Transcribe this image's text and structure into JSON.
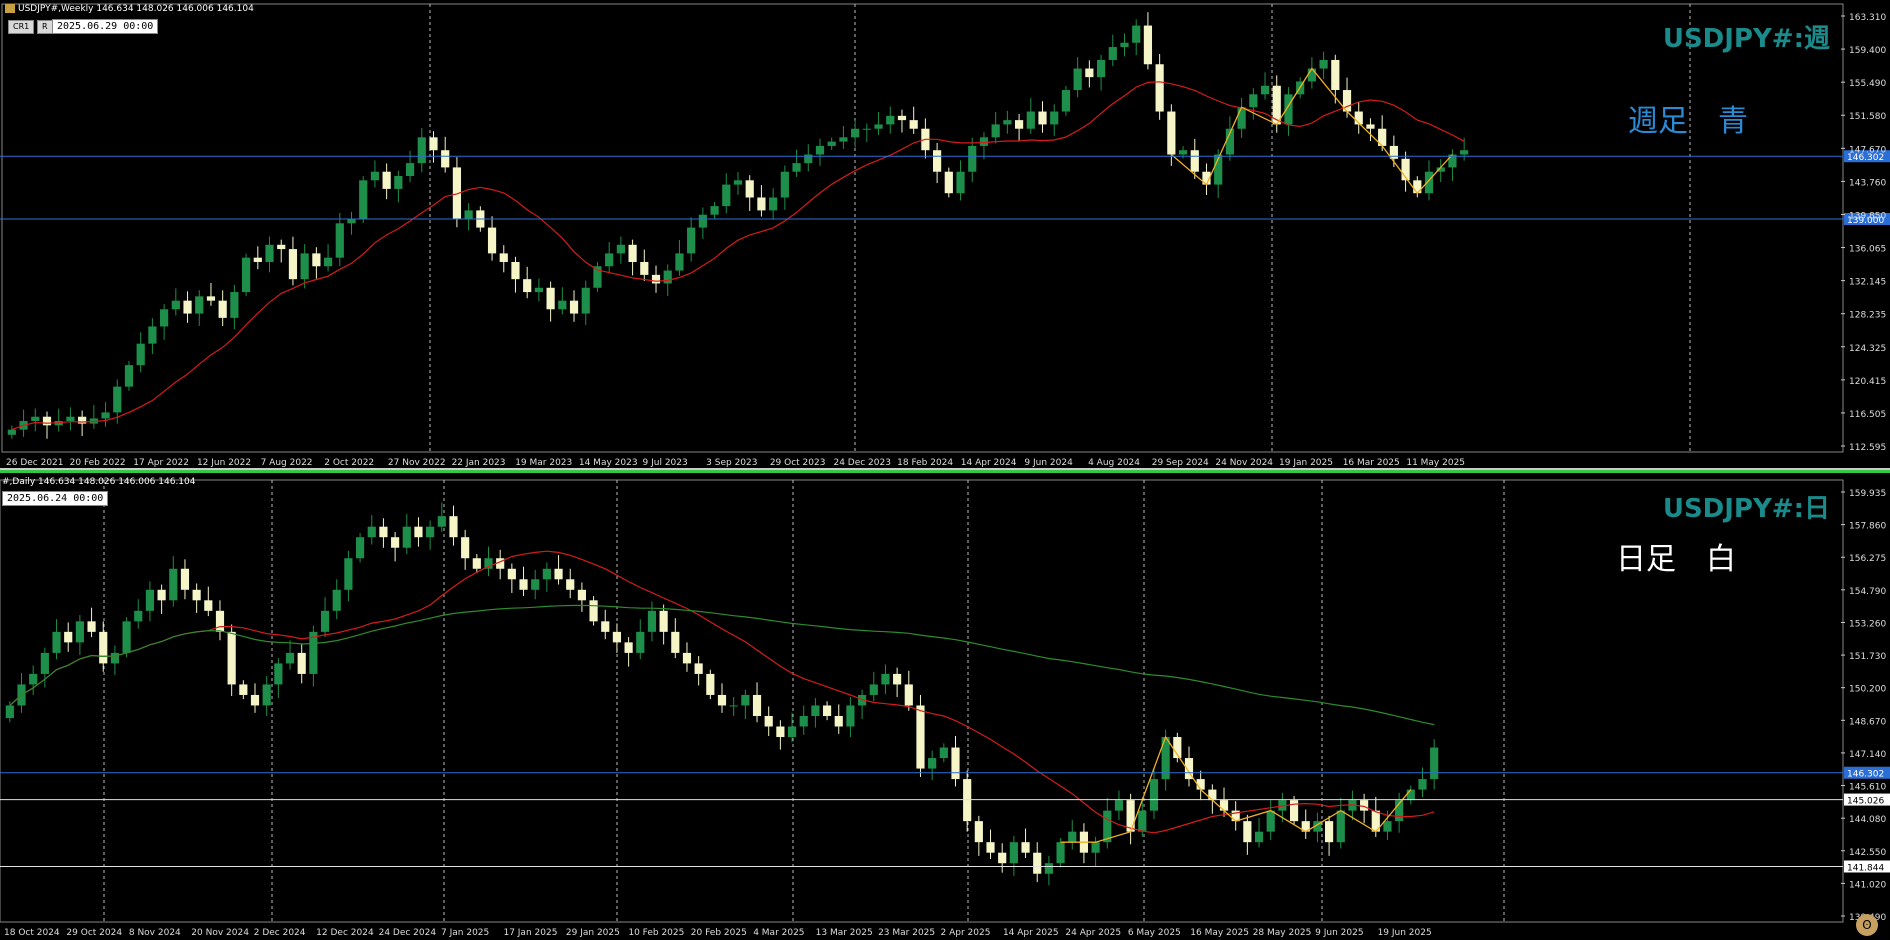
{
  "colors": {
    "background": "#000000",
    "bull_candle": "#1e8f4a",
    "bear_candle": "#f5f5c8",
    "ma_red": "#d41c1c",
    "ma_green": "#2e8b2e",
    "blue_line": "#2b6fd6",
    "white_line": "#e0e0e0",
    "zigzag": "#f0b020",
    "title_teal": "#1b8a8a"
  },
  "weekly": {
    "symbol_header": "USDJPY#,Weekly  146.634 148.026 146.006 146.104",
    "btn_cr1": "CR1",
    "btn_r": "R",
    "time_box": "2025.06.29 00:00",
    "chart_title": "USDJPY#:週",
    "note": "週足　青",
    "note_color": "#2b8ad6",
    "hline_labels": [
      "146.302",
      "139.000"
    ],
    "y_ticks": [
      "163.310",
      "159.400",
      "155.490",
      "151.580",
      "147.670",
      "143.760",
      "139.850",
      "136.065",
      "132.145",
      "128.235",
      "124.325",
      "120.415",
      "116.505",
      "112.595"
    ],
    "x_ticks": [
      "26 Dec 2021",
      "20 Feb 2022",
      "17 Apr 2022",
      "12 Jun 2022",
      "7 Aug 2022",
      "2 Oct 2022",
      "27 Nov 2022",
      "22 Jan 2023",
      "19 Mar 2023",
      "14 May 2023",
      "9 Jul 2023",
      "3 Sep 2023",
      "29 Oct 2023",
      "24 Dec 2023",
      "18 Feb 2024",
      "14 Apr 2024",
      "9 Jun 2024",
      "4 Aug 2024",
      "29 Sep 2024",
      "24 Nov 2024",
      "19 Jan 2025",
      "16 Mar 2025",
      "11 May 2025"
    ]
  },
  "daily": {
    "symbol_header": "#,Daily  146.634 148.026 146.006 146.104",
    "time_box": "2025.06.24 00:00",
    "chart_title": "USDJPY#:日",
    "note": "日足　白",
    "note_color": "#ffffff",
    "hline_labels": [
      "146.302",
      "145.026",
      "141.844"
    ],
    "y_ticks": [
      "159.935",
      "158.405",
      "156.875",
      "155.345",
      "153.815",
      "152.285",
      "150.755",
      "149.225",
      "147.695",
      "146.165",
      "144.635",
      "143.105",
      "141.575",
      "140.045"
    ],
    "y_ticks_shown": [
      "159.935",
      "157.860",
      "156.275",
      "154.790",
      "153.260",
      "151.730",
      "150.200",
      "148.670",
      "147.140",
      "145.610",
      "144.080",
      "142.550",
      "141.020",
      "139.490"
    ],
    "x_ticks": [
      "18 Oct 2024",
      "29 Oct 2024",
      "8 Nov 2024",
      "20 Nov 2024",
      "2 Dec 2024",
      "12 Dec 2024",
      "24 Dec 2024",
      "7 Jan 2025",
      "17 Jan 2025",
      "29 Jan 2025",
      "10 Feb 2025",
      "20 Feb 2025",
      "4 Mar 2025",
      "13 Mar 2025",
      "23 Mar 2025",
      "2 Apr 2025",
      "14 Apr 2025",
      "24 Apr 2025",
      "6 May 2025",
      "16 May 2025",
      "28 May 2025",
      "9 Jun 2025",
      "19 Jun 2025"
    ]
  },
  "chart_data": [
    {
      "type": "candlestick",
      "title": "USDJPY#:週",
      "timeframe": "Weekly",
      "ylim": [
        112.595,
        163.31
      ],
      "horizontal_lines": [
        146.302,
        139.0
      ],
      "closes_approx": [
        114.5,
        115.5,
        116.0,
        115.0,
        115.5,
        116.0,
        115.2,
        115.8,
        116.5,
        119.5,
        122.0,
        124.5,
        126.5,
        128.5,
        129.5,
        128.0,
        130.0,
        129.5,
        127.5,
        130.5,
        134.5,
        134.0,
        136.0,
        135.5,
        132.0,
        135.0,
        133.5,
        134.5,
        138.5,
        139.0,
        143.5,
        144.5,
        142.5,
        144.0,
        145.5,
        148.5,
        147.0,
        145.0,
        139.0,
        140.0,
        138.0,
        135.0,
        134.0,
        132.0,
        130.5,
        131.0,
        128.5,
        129.5,
        128.0,
        131.0,
        133.5,
        135.0,
        136.0,
        134.0,
        132.5,
        131.5,
        133.0,
        135.0,
        138.0,
        139.5,
        140.5,
        143.0,
        143.5,
        141.5,
        140.0,
        141.5,
        144.5,
        145.5,
        146.5,
        147.5,
        148.0,
        148.5,
        149.5,
        149.5,
        150.0,
        151.0,
        150.5,
        149.5,
        147.0,
        144.5,
        142.0,
        144.5,
        147.5,
        148.5,
        150.0,
        150.5,
        149.5,
        151.5,
        150.0,
        151.5,
        154.0,
        156.5,
        155.5,
        157.5,
        159.0,
        159.5,
        161.5,
        157.0,
        151.5,
        146.5,
        147.0,
        144.5,
        143.0,
        146.5,
        149.5,
        152.0,
        153.5,
        154.5,
        150.0,
        153.5,
        155.0,
        156.5,
        157.5,
        154.0,
        151.5,
        150.0,
        149.5,
        147.5,
        146.0,
        143.5,
        142.0,
        144.5,
        145.0,
        146.5,
        147.0
      ],
      "ma_note": "red moving average"
    },
    {
      "type": "candlestick",
      "title": "USDJPY#:日",
      "timeframe": "Daily",
      "ylim": [
        139.49,
        159.935
      ],
      "horizontal_lines": [
        146.302,
        145.026,
        141.844
      ],
      "closes_approx": [
        149.5,
        150.5,
        151.0,
        152.0,
        153.0,
        152.5,
        153.5,
        153.0,
        151.5,
        152.0,
        153.5,
        154.0,
        155.0,
        154.5,
        156.0,
        155.0,
        154.5,
        154.0,
        153.0,
        150.5,
        150.0,
        149.5,
        150.5,
        151.5,
        152.0,
        151.0,
        153.0,
        154.0,
        155.0,
        156.5,
        157.5,
        158.0,
        157.5,
        157.0,
        158.0,
        157.5,
        158.0,
        158.5,
        157.5,
        156.5,
        156.0,
        156.5,
        156.0,
        155.5,
        155.0,
        155.5,
        156.0,
        155.5,
        155.0,
        154.5,
        153.5,
        153.0,
        152.5,
        152.0,
        153.0,
        154.0,
        153.0,
        152.0,
        151.5,
        151.0,
        150.0,
        149.5,
        149.5,
        150.0,
        149.0,
        148.5,
        148.0,
        148.5,
        149.0,
        149.5,
        149.0,
        148.5,
        149.5,
        150.0,
        150.5,
        151.0,
        150.5,
        149.5,
        146.5,
        147.0,
        147.5,
        146.0,
        144.0,
        143.0,
        142.5,
        142.0,
        143.0,
        142.5,
        141.5,
        142.0,
        143.0,
        143.5,
        142.5,
        143.0,
        144.5,
        145.0,
        143.5,
        144.5,
        146.0,
        148.0,
        147.0,
        146.0,
        145.5,
        145.0,
        144.5,
        144.0,
        143.0,
        143.5,
        144.5,
        145.0,
        144.0,
        143.5,
        144.0,
        143.0,
        144.5,
        145.0,
        144.5,
        143.5,
        144.0,
        145.0,
        145.5,
        146.0,
        147.5
      ],
      "ma_note": "red short MA, green long MA"
    }
  ]
}
